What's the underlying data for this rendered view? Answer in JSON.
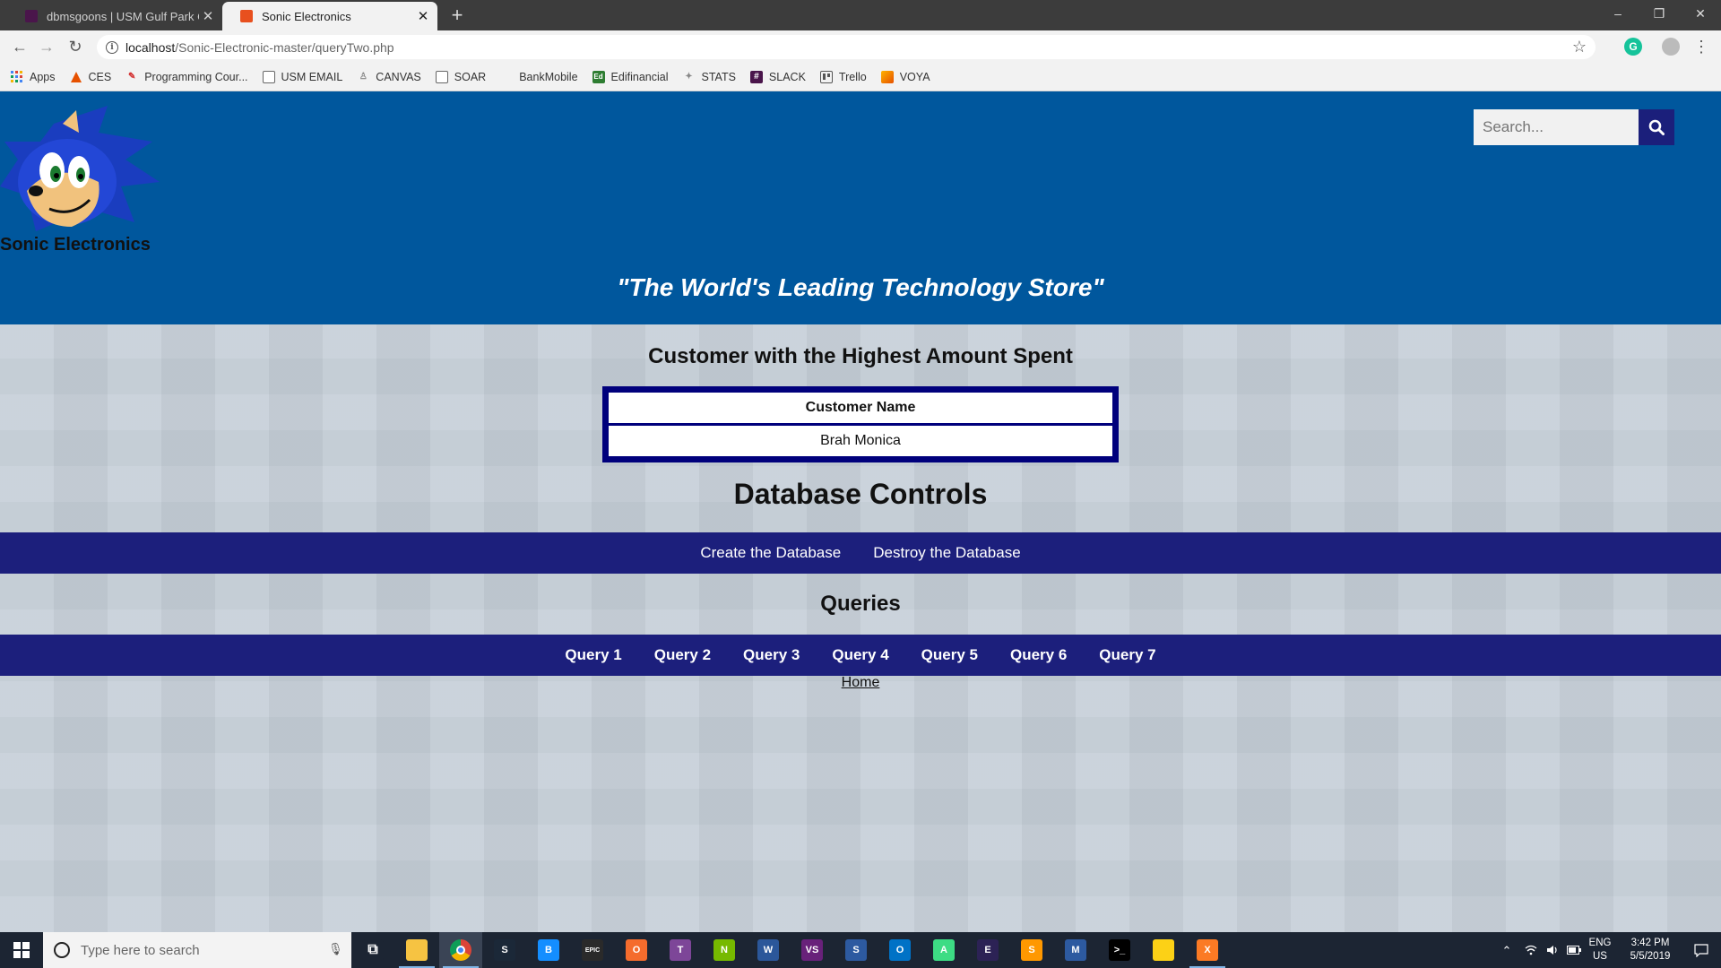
{
  "browser": {
    "tabs": [
      {
        "title": "dbmsgoons | USM Gulf Park Con",
        "favicon_color": "#4a154b",
        "active": false
      },
      {
        "title": "Sonic Electronics",
        "favicon_color": "#e8501e",
        "active": true
      }
    ],
    "new_tab_glyph": "+",
    "window_controls": {
      "minimize": "–",
      "restore": "❐",
      "close": "✕"
    },
    "nav": {
      "back": "←",
      "forward": "→",
      "reload": "↻"
    },
    "url_host": "localhost",
    "url_path": "/Sonic-Electronic-master/queryTwo.php",
    "info_glyph": "i",
    "star_glyph": "☆",
    "menu_glyph": "⋮",
    "grammarly_glyph": "G",
    "bookmarks": [
      {
        "label": "Apps",
        "icon": "apps-grid-icon",
        "color": "#db4437"
      },
      {
        "label": "CES",
        "icon": "ces-icon",
        "color": "#e65100"
      },
      {
        "label": "Programming Cour...",
        "icon": "programming-icon",
        "color": "#d32f2f"
      },
      {
        "label": "USM EMAIL",
        "icon": "page-icon",
        "color": "#ffffff"
      },
      {
        "label": "CANVAS",
        "icon": "canvas-icon",
        "color": "#9e9e9e"
      },
      {
        "label": "SOAR",
        "icon": "page-icon",
        "color": "#ffffff"
      },
      {
        "label": "BankMobile",
        "icon": "bankmobile-icon",
        "color": "#f2f2f2"
      },
      {
        "label": "Edifinancial",
        "icon": "edifinancial-icon",
        "color": "#2e7d32"
      },
      {
        "label": "STATS",
        "icon": "stats-icon",
        "color": "#9e9e9e"
      },
      {
        "label": "SLACK",
        "icon": "slack-icon",
        "color": "#4a154b"
      },
      {
        "label": "Trello",
        "icon": "trello-icon",
        "color": "#555555"
      },
      {
        "label": "VOYA",
        "icon": "voya-icon",
        "color": "#ff6f00"
      }
    ]
  },
  "site": {
    "brand": "Sonic Electronics",
    "tagline": "\"The World's Leading Technology Store\"",
    "search_placeholder": "Search...",
    "header_color": "#00579d",
    "nav_color": "#1c1f7c"
  },
  "result": {
    "title": "Customer with the Highest Amount Spent",
    "column_header": "Customer Name",
    "rows": [
      "Brah Monica"
    ]
  },
  "db_controls": {
    "title": "Database Controls",
    "links": [
      "Create the Database",
      "Destroy the Database"
    ]
  },
  "queries": {
    "title": "Queries",
    "links": [
      "Query 1",
      "Query 2",
      "Query 3",
      "Query 4",
      "Query 5",
      "Query 6",
      "Query 7"
    ]
  },
  "home_link": "Home",
  "taskbar": {
    "search_placeholder": "Type here to search",
    "apps": [
      {
        "name": "task-view",
        "glyph": "⧉",
        "color": "#1c2533"
      },
      {
        "name": "file-explorer",
        "glyph": "",
        "color": "#f6c342"
      },
      {
        "name": "chrome",
        "glyph": "",
        "color": "#db4437"
      },
      {
        "name": "steam",
        "glyph": "S",
        "color": "#1b2838"
      },
      {
        "name": "battle-net",
        "glyph": "B",
        "color": "#148eff"
      },
      {
        "name": "epic-games",
        "glyph": "EPIC",
        "color": "#2a2a2a"
      },
      {
        "name": "origin",
        "glyph": "O",
        "color": "#f56c2d"
      },
      {
        "name": "tor",
        "glyph": "T",
        "color": "#7d4698"
      },
      {
        "name": "nvidia",
        "glyph": "N",
        "color": "#76b900"
      },
      {
        "name": "word",
        "glyph": "W",
        "color": "#2b579a"
      },
      {
        "name": "visual-studio",
        "glyph": "VS",
        "color": "#68217a"
      },
      {
        "name": "sql-server",
        "glyph": "S",
        "color": "#2d5aa0"
      },
      {
        "name": "outlook",
        "glyph": "O",
        "color": "#0072c6"
      },
      {
        "name": "android-studio",
        "glyph": "A",
        "color": "#3ddc84"
      },
      {
        "name": "eclipse",
        "glyph": "E",
        "color": "#2c2255"
      },
      {
        "name": "sublime",
        "glyph": "S",
        "color": "#ff9800"
      },
      {
        "name": "mysql-workbench",
        "glyph": "M",
        "color": "#2d5aa0"
      },
      {
        "name": "terminal",
        "glyph": ">_",
        "color": "#000000"
      },
      {
        "name": "sticky-notes",
        "glyph": "",
        "color": "#fcd116"
      },
      {
        "name": "xampp",
        "glyph": "X",
        "color": "#fb7a24"
      }
    ],
    "language": "ENG",
    "region": "US",
    "time": "3:42 PM",
    "date": "5/5/2019"
  }
}
